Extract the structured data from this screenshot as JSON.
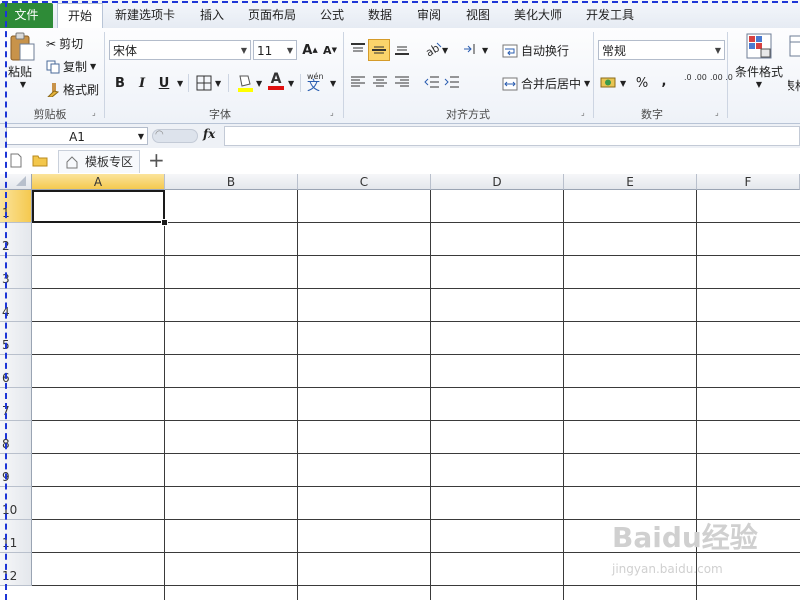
{
  "tabs": [
    {
      "label": "文件"
    },
    {
      "label": "开始"
    },
    {
      "label": "新建选项卡"
    },
    {
      "label": "插入"
    },
    {
      "label": "页面布局"
    },
    {
      "label": "公式"
    },
    {
      "label": "数据"
    },
    {
      "label": "审阅"
    },
    {
      "label": "视图"
    },
    {
      "label": "美化大师"
    },
    {
      "label": "开发工具"
    }
  ],
  "clipboard": {
    "paste": "粘贴",
    "cut": "剪切",
    "copy": "复制",
    "format_painter": "格式刷",
    "label": "剪贴板"
  },
  "font": {
    "name": "宋体",
    "size": "11",
    "label": "字体",
    "bold": "B",
    "italic": "I",
    "underline": "U",
    "grow": "A",
    "shrink": "A",
    "font_color": "A",
    "phonetic": "wén"
  },
  "alignment": {
    "wrap": "自动换行",
    "merge": "合并后居中",
    "label": "对齐方式"
  },
  "number": {
    "format": "常规",
    "percent": "%",
    "comma": ",",
    "inc": ".0 .00",
    "dec": ".00 .0",
    "label": "数字"
  },
  "styles": {
    "conditional": "条件格式",
    "table": "表格"
  },
  "formula_bar": {
    "name_box": "A1",
    "fx": "fx",
    "value": ""
  },
  "doc_tab": {
    "label": "模板专区",
    "add": "+"
  },
  "columns": [
    "A",
    "B",
    "C",
    "D",
    "E",
    "F"
  ],
  "rows": [
    "1",
    "2",
    "3",
    "4",
    "5",
    "6",
    "7",
    "8",
    "9",
    "10",
    "11",
    "12"
  ],
  "watermark": {
    "brand": "Baidu经验",
    "url": "jingyan.baidu.com"
  },
  "colors": {
    "file_tab": "#2e8b37",
    "selection_header": "#f5c94f",
    "dashed_frame": "#1d35d6"
  }
}
